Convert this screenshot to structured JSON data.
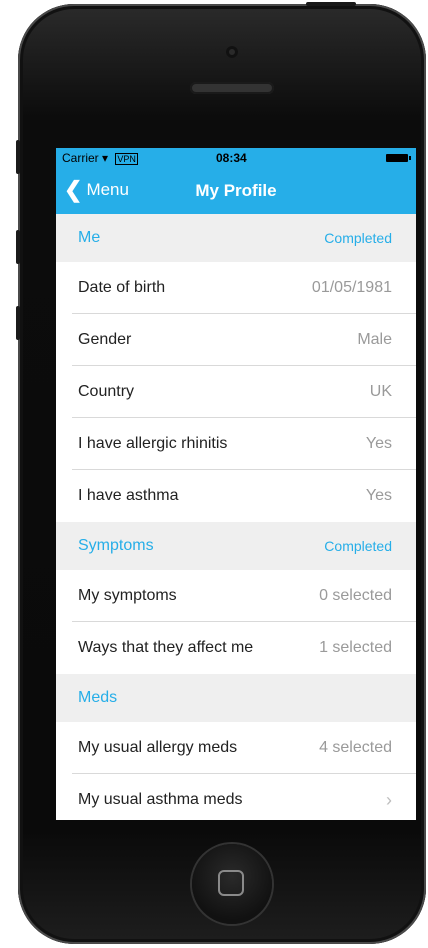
{
  "status_bar": {
    "carrier": "Carrier",
    "vpn": "VPN",
    "time": "08:34"
  },
  "nav": {
    "back_label": "Menu",
    "title": "My Profile"
  },
  "sections": [
    {
      "label": "Me",
      "status": "Completed",
      "rows": [
        {
          "label": "Date of birth",
          "value": "01/05/1981"
        },
        {
          "label": "Gender",
          "value": "Male"
        },
        {
          "label": "Country",
          "value": "UK"
        },
        {
          "label": "I have allergic rhinitis",
          "value": "Yes"
        },
        {
          "label": "I have asthma",
          "value": "Yes"
        }
      ]
    },
    {
      "label": "Symptoms",
      "status": "Completed",
      "rows": [
        {
          "label": "My symptoms",
          "value": "0 selected"
        },
        {
          "label": "Ways that they affect me",
          "value": "1 selected"
        }
      ]
    },
    {
      "label": "Meds",
      "status": "",
      "rows": [
        {
          "label": "My usual allergy meds",
          "value": "4 selected"
        },
        {
          "label": "My usual asthma meds",
          "value": ""
        }
      ]
    }
  ],
  "colors": {
    "accent": "#26aee8",
    "section_bg": "#efefef",
    "value_text": "#9a9a9a"
  }
}
